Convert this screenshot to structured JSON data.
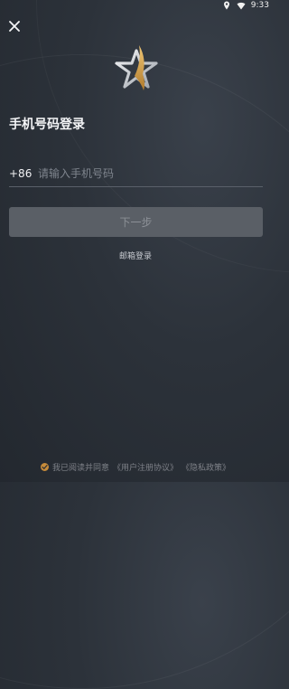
{
  "status_bar": {
    "time": "9:33",
    "location_icon": "location-pin-icon",
    "wifi_icon": "wifi-icon"
  },
  "header": {
    "close_icon": "close-icon"
  },
  "logo": {
    "icon": "star-logo-icon",
    "accent_color": "#d6a04a"
  },
  "title": "手机号码登录",
  "phone": {
    "country_code": "+86",
    "placeholder": "请输入手机号码",
    "value": ""
  },
  "next_button_label": "下一步",
  "email_login_label": "邮箱登录",
  "agreement": {
    "prefix": "我已阅读并同意",
    "user_agreement": "《用户注册协议》",
    "privacy_policy": "《隐私政策》",
    "checked": true
  }
}
